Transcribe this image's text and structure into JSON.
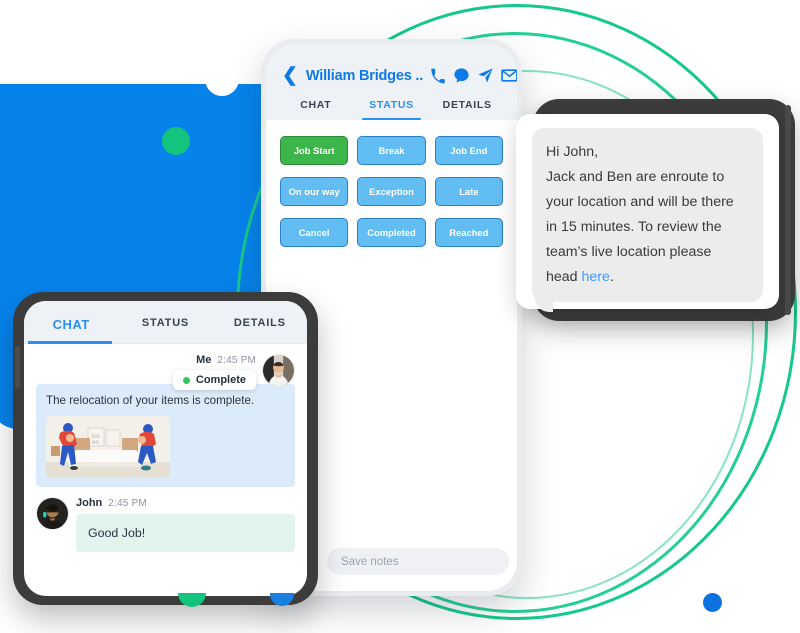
{
  "colors": {
    "brand_blue": "#0683eb",
    "accent_blue": "#0d7ae8",
    "ring_green": "#14c98a",
    "dot_green": "#13c47f",
    "status_button_blue": "#61bdf2",
    "status_button_green": "#3cb54a",
    "device_dark": "#3c3c3c",
    "bubble_gray": "#ececec",
    "bubble_me_blue": "#dcebfb",
    "bubble_john_green": "#e3f4ef",
    "link_blue": "#3b9bff"
  },
  "main_phone": {
    "header": {
      "back_icon": "chevron-left-icon",
      "contact_name": "William Bridges ..",
      "icons": [
        "phone-icon",
        "chat-bubble-icon",
        "paper-plane-icon",
        "envelope-icon"
      ]
    },
    "tabs": [
      {
        "label": "CHAT",
        "active": false
      },
      {
        "label": "STATUS",
        "active": true
      },
      {
        "label": "DETAILS",
        "active": false
      }
    ],
    "status_buttons": [
      {
        "label": "Job Start",
        "variant": "green"
      },
      {
        "label": "Break",
        "variant": "blue"
      },
      {
        "label": "Job End",
        "variant": "blue"
      },
      {
        "label": "On our way",
        "variant": "blue"
      },
      {
        "label": "Exception",
        "variant": "blue"
      },
      {
        "label": "Late",
        "variant": "blue"
      },
      {
        "label": "Cancel",
        "variant": "blue"
      },
      {
        "label": "Completed",
        "variant": "blue"
      },
      {
        "label": "Reached",
        "variant": "blue"
      }
    ],
    "compose": {
      "attach_icon": "paperclip-icon",
      "preview_icon": "eye-icon",
      "placeholder": "Save notes",
      "value": "",
      "send_icon": "send-arrow-icon"
    }
  },
  "message_card": {
    "lines": [
      "Hi John,",
      "Jack and Ben are enroute to",
      "your location and will be there",
      "in 15 minutes. To review the",
      "team’s live location please"
    ],
    "last_line_prefix": "head ",
    "link_text": "here",
    "last_line_suffix": "."
  },
  "chat_phone": {
    "tabs": [
      {
        "label": "CHAT",
        "active": true
      },
      {
        "label": "STATUS",
        "active": false
      },
      {
        "label": "DETAILS",
        "active": false
      }
    ],
    "messages": [
      {
        "sender": "Me",
        "time": "2:45 PM",
        "badge": "Complete",
        "text": "The relocation of your items is complete.",
        "has_photo": true,
        "photo_alt": "movers-carrying-sofa-photo"
      },
      {
        "sender": "John",
        "time": "2:45 PM",
        "text": "Good Job!",
        "has_photo": false
      }
    ]
  }
}
